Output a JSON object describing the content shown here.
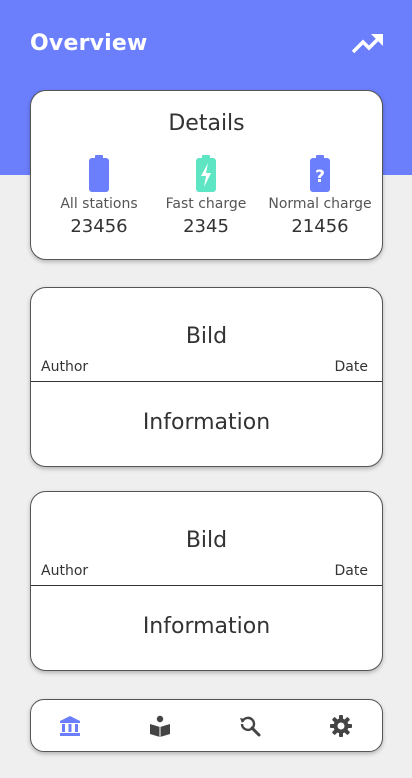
{
  "header": {
    "title": "Overview",
    "trend_icon": "trending-up-icon"
  },
  "details": {
    "title": "Details",
    "stats": [
      {
        "label": "All stations",
        "value": "23456",
        "icon": "battery-icon",
        "color": "#6b7efb"
      },
      {
        "label": "Fast charge",
        "value": "2345",
        "icon": "battery-charging-icon",
        "color": "#5ee6c4"
      },
      {
        "label": "Normal charge",
        "value": "21456",
        "icon": "battery-unknown-icon",
        "color": "#6b7efb"
      }
    ]
  },
  "cards": [
    {
      "image_label": "Bild",
      "author": "Author",
      "date": "Date",
      "info": "Information"
    },
    {
      "image_label": "Bild",
      "author": "Author",
      "date": "Date",
      "info": "Information"
    }
  ],
  "nav": {
    "active_color": "#6b7efb",
    "inactive_color": "#444444",
    "items": [
      {
        "icon": "bank-icon",
        "active": true
      },
      {
        "icon": "book-reader-icon",
        "active": false
      },
      {
        "icon": "search-refresh-icon",
        "active": false
      },
      {
        "icon": "gear-icon",
        "active": false
      }
    ]
  }
}
